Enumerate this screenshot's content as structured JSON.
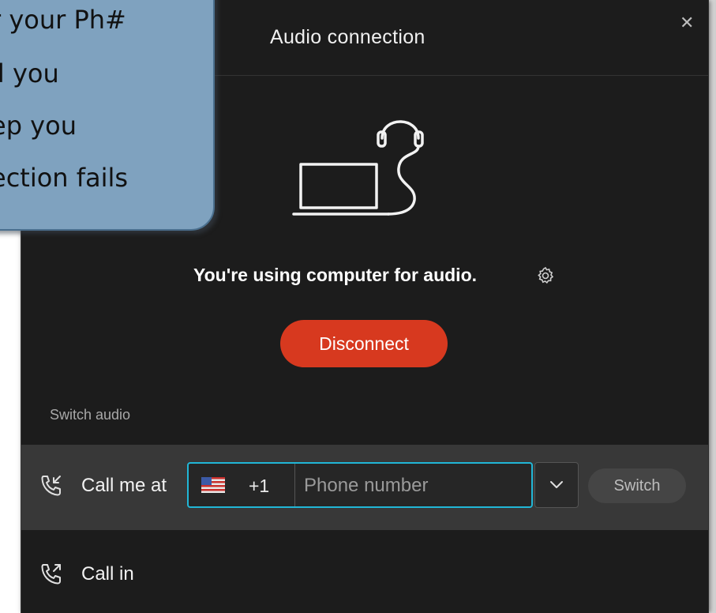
{
  "tooltip": {
    "lines": [
      "r your Ph#",
      "ll you",
      "ep you",
      "ection fails"
    ]
  },
  "dialog": {
    "title": "Audio connection",
    "close_icon": "close-icon",
    "status_text": "You're using computer for audio.",
    "settings_icon": "gear-icon",
    "disconnect_label": "Disconnect",
    "switch_audio_label": "Switch audio",
    "call_me": {
      "label": "Call me at",
      "icon": "phone-incoming-icon",
      "country_flag": "us-flag-icon",
      "country_code": "+1",
      "phone_placeholder": "Phone number",
      "phone_value": "",
      "dropdown_icon": "chevron-down-icon",
      "switch_label": "Switch"
    },
    "call_in": {
      "label": "Call in",
      "icon": "phone-outgoing-icon"
    }
  },
  "colors": {
    "dialog_bg": "#1c1c1c",
    "row_highlight": "#383838",
    "accent_focus": "#21b6d6",
    "disconnect_bg": "#d7391f",
    "tooltip_bg": "#7fa2bf"
  }
}
